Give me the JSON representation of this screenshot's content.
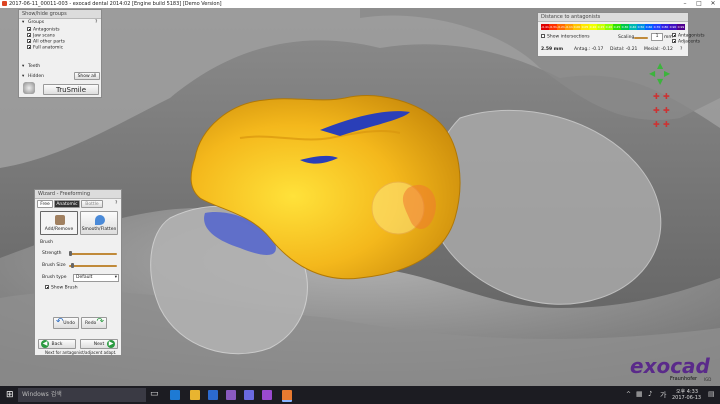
{
  "window": {
    "title": "2017-06-11_00011-003 - exocad dental 2014:02 [Engine build 5183] [Demo Version]",
    "minimize": "–",
    "maximize": "□",
    "close": "✕"
  },
  "groups_panel": {
    "title": "Show/hide groups",
    "help": "?",
    "groups_header": "Groups",
    "items": [
      {
        "label": "Antagonists",
        "checked": true
      },
      {
        "label": "Jaw scans",
        "checked": true
      },
      {
        "label": "All other parts",
        "checked": true
      },
      {
        "label": "Full anatomic",
        "checked": true
      }
    ],
    "teeth_header": "Teeth",
    "hidden_header": "Hidden",
    "show_all": "Show all",
    "trusmile": "TruSmile"
  },
  "distance_panel": {
    "title": "Distance to antagonists",
    "scale_labels": [
      "-0.41",
      "-0.31",
      "-0.21",
      "-0.11",
      "0.00",
      "0.05",
      "0.10",
      "0.15",
      "0.20",
      "0.25",
      "0.30",
      "0.40",
      "0.50",
      "0.60",
      "0.70",
      "0.80",
      "0.90",
      "0.99"
    ],
    "show_intersections": "Show intersections",
    "scaling": "Scaling",
    "scaling_value": "1",
    "scaling_unit": "mm",
    "antagonists": "Antagonists",
    "adjacents": "Adjacents",
    "readout_distance": "2.59 mm",
    "readout_antag": "Antag.: -0.17",
    "readout_distal": "Distal: -0.21",
    "readout_mesial": "Mesial: -0.12",
    "help": "?",
    "colors": [
      "#e00000",
      "#ff3000",
      "#ff6a00",
      "#ff9a00",
      "#ffc400",
      "#ffe800",
      "#f0ff00",
      "#c8ff00",
      "#8cff00",
      "#2ee000",
      "#00c84a",
      "#00b8b0",
      "#0090e0",
      "#0060ff",
      "#2040ff",
      "#3020e0",
      "#4010c0",
      "#500090"
    ]
  },
  "wizard_panel": {
    "title": "Wizard - Freeforming",
    "tabs": [
      "Free",
      "Anatomic",
      "Bottle"
    ],
    "tools": [
      "Add/Remove",
      "Smooth/Flatten"
    ],
    "brush_header": "Brush",
    "strength": "Strength",
    "brush_size": "Brush Size",
    "brush_type": "Brush type",
    "brush_type_value": "Default",
    "show_brush": "Show Brush",
    "undo": "Undo",
    "redo": "Redo",
    "back": "Back",
    "next": "Next",
    "hint": "Next for antagonist/adjacent adapt.",
    "help": "?"
  },
  "brand": {
    "logo": "exocad",
    "sub": "Fraunhofer",
    "sub2": "IGD"
  },
  "taskbar": {
    "search_placeholder": "Windows 검색",
    "time": "오후 4:33",
    "date": "2017-06-13",
    "lang": "가"
  },
  "model_colors": {
    "crown": "#f0b21e",
    "contact": "#2a3fb8",
    "background": "#7a7a7a"
  }
}
